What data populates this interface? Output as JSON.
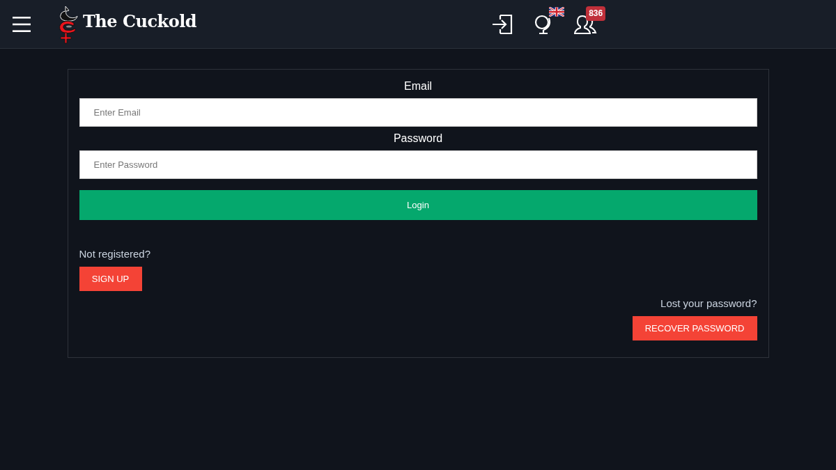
{
  "header": {
    "title": "The Cuckold",
    "user_badge": "836"
  },
  "login_form": {
    "fields": [
      {
        "label": "Email",
        "placeholder": "Enter Email"
      },
      {
        "label": "Password",
        "placeholder": "Enter Password"
      }
    ],
    "submit_button": "Login"
  },
  "register": {
    "prompt": "Not registered?",
    "button": "SIGN UP"
  },
  "recover": {
    "prompt": "Lost your password?",
    "button": "RECOVER PASSWORD"
  }
}
